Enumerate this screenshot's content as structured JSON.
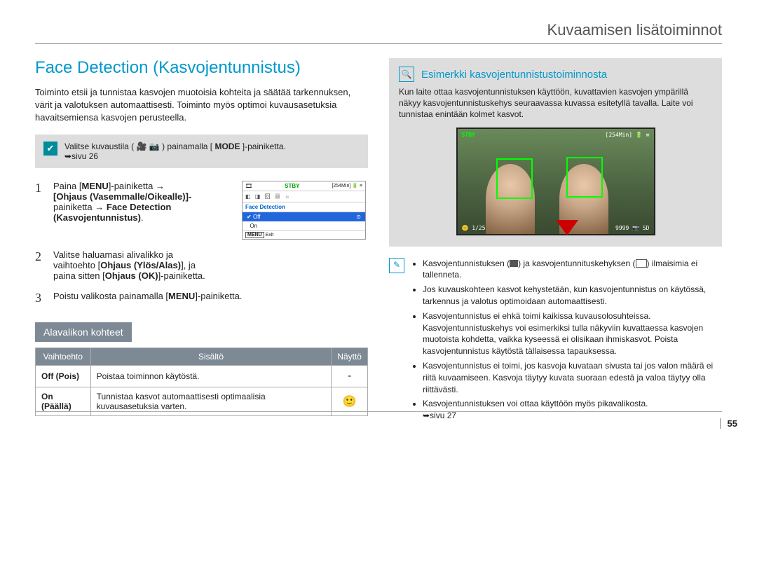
{
  "header": {
    "chapter": "Kuvaamisen lisätoiminnot"
  },
  "left": {
    "title": "Face Detection (Kasvojentunnistus)",
    "intro": "Toiminto etsii ja tunnistaa kasvojen muotoisia kohteita ja säätää tarkennuksen, värit ja valotuksen automaattisesti. Toiminto myös optimoi kuvausasetuksia havaitsemiensa kasvojen perusteella.",
    "mode_note": {
      "prefix": "Valitse kuvaustila (",
      "icons": "🎥 📷",
      "mid": ") painamalla [",
      "button": "MODE",
      "suffix": "]-painiketta.",
      "pageref": "➥sivu 26"
    },
    "step1": {
      "num": "1",
      "l1a": "Paina [",
      "l1b": "MENU",
      "l1c": "]-painiketta →",
      "l2": "[Ohjaus (Vasemmalle/Oikealle)]-",
      "l3a": "painiketta → ",
      "l3b": "Face Detection",
      "l4": "(Kasvojentunnistus)"
    },
    "lcd": {
      "stby": "STBY",
      "time": "[254Min]",
      "tab": "Face Detection",
      "off": "Off",
      "on": "On",
      "menu": "MENU",
      "exit": "Exit"
    },
    "step2": {
      "num": "2",
      "l1": "Valitse haluamasi alivalikko ja",
      "l2a": "vaihtoehto [",
      "l2b": "Ohjaus (Ylös/Alas)",
      "l2c": "], ja",
      "l3a": "paina sitten [",
      "l3b": "Ohjaus (OK)",
      "l3c": "]-painiketta."
    },
    "step3": {
      "num": "3",
      "l1a": "Poistu valikosta painamalla [",
      "l1b": "MENU",
      "l1c": "]-painiketta."
    },
    "subheader": "Alavalikon kohteet",
    "table": {
      "h1": "Vaihtoehto",
      "h2": "Sisältö",
      "h3": "Näyttö",
      "r1c1": "Off (Pois)",
      "r1c2": "Poistaa toiminnon käytöstä.",
      "r1c3": "-",
      "r2c1": "On (Päällä)",
      "r2c2": "Tunnistaa kasvot automaattisesti optimaalisia kuvausasetuksia varten.",
      "r2c3": "🙂"
    }
  },
  "right": {
    "example_title": "Esimerkki kasvojentunnistustoiminnosta",
    "example_text": "Kun laite ottaa kasvojentunnistuksen käyttöön, kuvattavien kasvojen ympärillä näkyy kasvojentunnistuskehys seuraavassa kuvassa esitetyllä tavalla. Laite voi tunnistaa enintään kolmet kasvot.",
    "preview": {
      "stby": "STBY",
      "time": "[254Min]",
      "left_bottom": "🙂 1/25",
      "right_bottom": "9999 📷 SD"
    },
    "info_icon": "✎",
    "bullets": {
      "b1a": "Kasvojentunnistuksen (",
      "b1b": ") ja kasvojentunnituskehyksen (",
      "b1c": ") ilmaisimia ei tallenneta.",
      "b2": "Jos kuvauskohteen kasvot kehystetään, kun kasvojentunnistus on käytössä, tarkennus ja valotus optimoidaan automaattisesti.",
      "b3": "Kasvojentunnistus ei ehkä toimi kaikissa kuvausolosuhteissa. Kasvojentunnistuskehys voi esimerkiksi tulla näkyviin kuvattaessa kasvojen muotoista kohdetta, vaikka kyseessä ei olisikaan ihmiskasvot. Poista kasvojentunnistus käytöstä tällaisessa tapauksessa.",
      "b4": "Kasvojentunnistus ei toimi, jos kasvoja kuvataan sivusta tai jos valon määrä ei riitä kuvaamiseen. Kasvoja täytyy kuvata suoraan edestä ja valoa täytyy olla riittävästi.",
      "b5": "Kasvojentunnistuksen voi ottaa käyttöön myös pikavalikosta.",
      "b5ref": "➥sivu 27"
    }
  },
  "page_number": "55"
}
